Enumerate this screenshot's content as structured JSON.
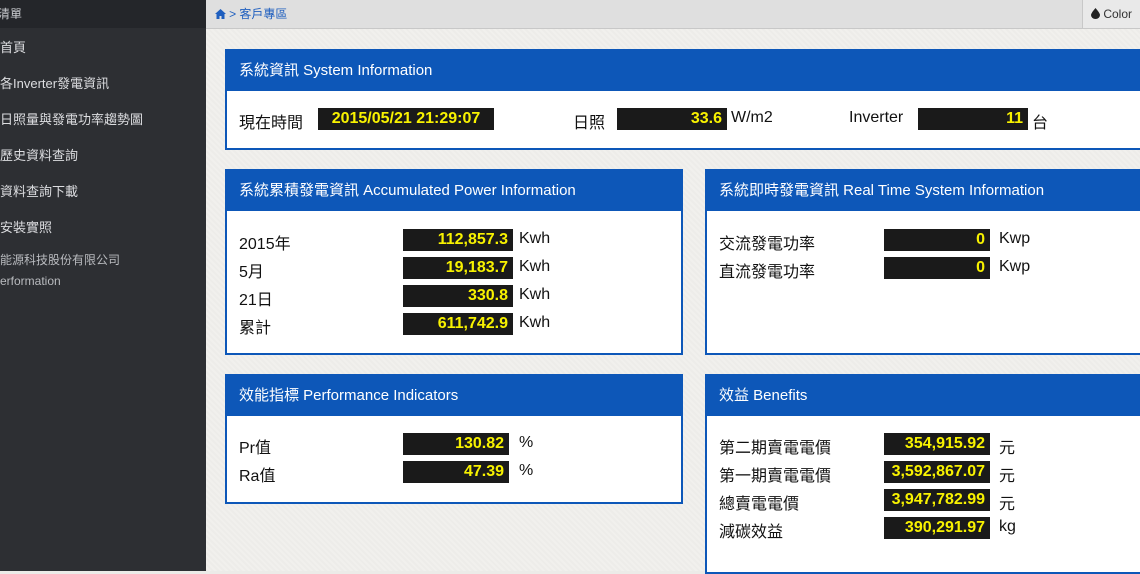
{
  "sidebar": {
    "title": "清單",
    "items": [
      "首頁",
      "各Inverter發電資訊",
      "日照量與發電功率趨勢圖",
      "歷史資料查詢",
      "資料查詢下載",
      "安裝實照"
    ],
    "footer": [
      "能源科技股份有限公司",
      "erformation"
    ]
  },
  "topbar": {
    "home_icon": "house-icon",
    "separator": ">",
    "breadcrumb": "客戶專區",
    "color_icon": "droplet-icon",
    "color_label": "Color"
  },
  "system": {
    "title": "系統資訊 System Information",
    "time_label": "現在時間",
    "time_value": "2015/05/21 21:29:07",
    "sun_label": "日照",
    "sun_value": "33.6",
    "sun_unit": "W/m2",
    "inverter_label": "Inverter",
    "inverter_value": "11",
    "inverter_unit": "台"
  },
  "accumulated": {
    "title": "系統累積發電資訊 Accumulated Power Information",
    "rows": [
      {
        "label": "2015年",
        "value": "112,857.3",
        "unit": "Kwh"
      },
      {
        "label": "5月",
        "value": "19,183.7",
        "unit": "Kwh"
      },
      {
        "label": "21日",
        "value": "330.8",
        "unit": "Kwh"
      },
      {
        "label": "累計",
        "value": "611,742.9",
        "unit": "Kwh"
      }
    ]
  },
  "realtime": {
    "title": "系統即時發電資訊 Real Time System Information",
    "rows": [
      {
        "label": "交流發電功率",
        "value": "0",
        "unit": "Kwp"
      },
      {
        "label": "直流發電功率",
        "value": "0",
        "unit": "Kwp"
      }
    ]
  },
  "performance": {
    "title": "效能指標 Performance Indicators",
    "rows": [
      {
        "label": "Pr值",
        "value": "130.82",
        "unit": "%"
      },
      {
        "label": "Ra值",
        "value": "47.39",
        "unit": "%"
      }
    ]
  },
  "benefits": {
    "title": "效益 Benefits",
    "rows": [
      {
        "label": "第二期賣電電價",
        "value": "354,915.92",
        "unit": "元"
      },
      {
        "label": "第一期賣電電價",
        "value": "3,592,867.07",
        "unit": "元"
      },
      {
        "label": "總賣電電價",
        "value": "3,947,782.99",
        "unit": "元"
      },
      {
        "label": "減碳效益",
        "value": "390,291.97",
        "unit": "kg"
      }
    ]
  },
  "colors": {
    "panel_blue": "#0d57b8",
    "value_bg": "#1a1a1a",
    "value_text": "#f8f200",
    "sidebar_bg": "#2d2f33"
  }
}
